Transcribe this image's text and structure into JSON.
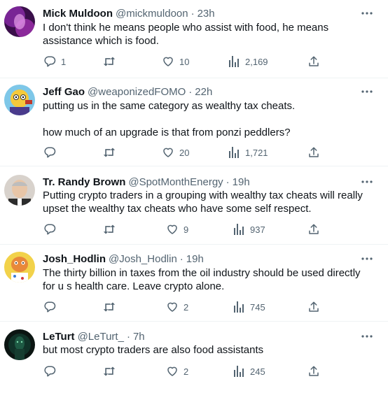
{
  "tweets": [
    {
      "name": "Mick Muldoon",
      "handle": "@mickmuldoon",
      "time": "23h",
      "text": "I don't think he means people who assist with food, he means assistance which is food.",
      "replies": "1",
      "retweets": "",
      "likes": "10",
      "views": "2,169",
      "avatar_color": "#5b1a6e"
    },
    {
      "name": "Jeff Gao",
      "handle": "@weaponizedFOMO",
      "time": "22h",
      "text": "putting us in the same category as wealthy tax cheats.\n\nhow much of an upgrade is that from ponzi peddlers?",
      "replies": "",
      "retweets": "",
      "likes": "20",
      "views": "1,721",
      "avatar_color": "#f5c93c"
    },
    {
      "name": "Tr. Randy Brown",
      "handle": "@SpotMonthEnergy",
      "time": "19h",
      "text": "Putting crypto traders in a grouping with wealthy tax cheats will really upset the wealthy tax cheats who have some self respect.",
      "replies": "",
      "retweets": "",
      "likes": "9",
      "views": "937",
      "avatar_color": "#b8a89a"
    },
    {
      "name": "Josh_Hodlin",
      "handle": "@Josh_Hodlin",
      "time": "19h",
      "text": "The thirty billion in taxes from the oil industry should be used directly for u s health care. Leave crypto alone.",
      "replies": "",
      "retweets": "",
      "likes": "2",
      "views": "745",
      "avatar_color": "#f2d24a"
    },
    {
      "name": "LeTurt",
      "handle": "@LeTurt_",
      "time": "7h",
      "text": "but most crypto traders are also food assistants",
      "replies": "",
      "retweets": "",
      "likes": "2",
      "views": "245",
      "avatar_color": "#0f2a22"
    }
  ],
  "separator": "·",
  "icons": {
    "more": "more-dots-icon",
    "reply": "reply-bubble-icon",
    "retweet": "retweet-icon",
    "like": "heart-icon",
    "views": "bar-chart-icon",
    "share": "share-upload-icon"
  }
}
